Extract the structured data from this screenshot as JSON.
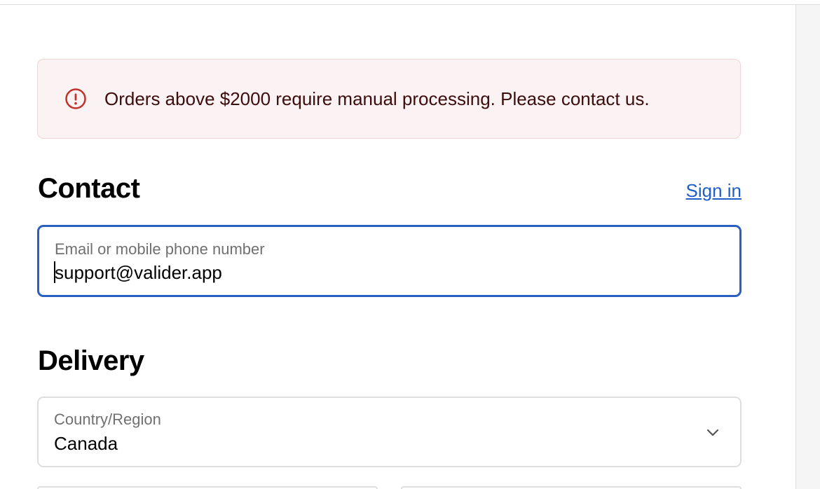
{
  "alert": {
    "icon": "alert-circle-icon",
    "message": "Orders above $2000 require manual processing. Please contact us.",
    "color": "#c0322c"
  },
  "contact": {
    "heading": "Contact",
    "signin_label": "Sign in",
    "email_field": {
      "label": "Email or mobile phone number",
      "value": "support@valider.app"
    }
  },
  "delivery": {
    "heading": "Delivery",
    "country_field": {
      "label": "Country/Region",
      "value": "Canada",
      "icon": "chevron-down-icon"
    }
  },
  "colors": {
    "accent": "#1f5fc9",
    "focus_border": "#2a5fc0",
    "alert_bg": "#fbf3f3",
    "alert_text": "#3d0c0c"
  }
}
